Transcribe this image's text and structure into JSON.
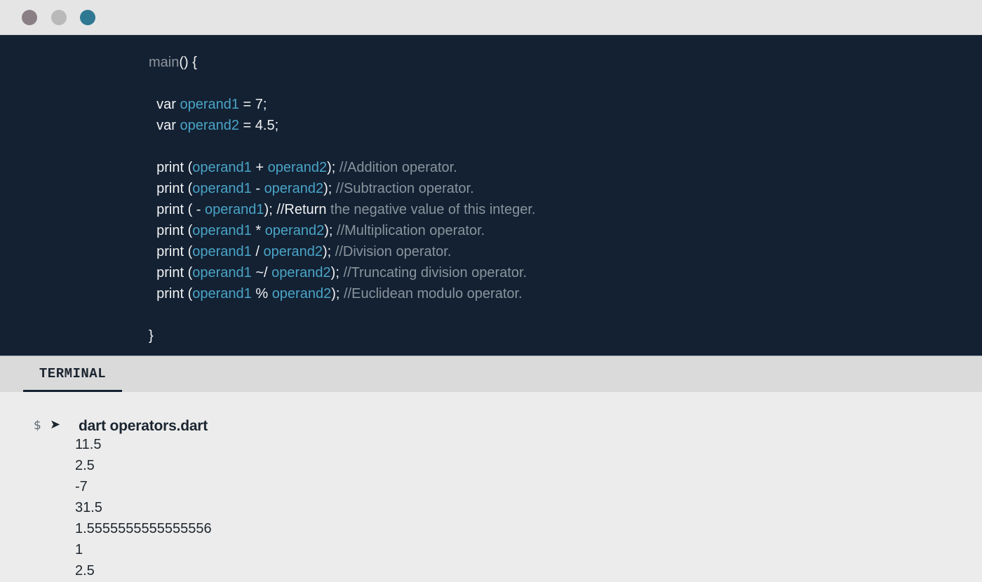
{
  "window": {
    "controls": [
      "close",
      "minimize",
      "maximize"
    ],
    "control_colors": [
      "#8a7f84",
      "#b9b9b9",
      "#2e7892"
    ]
  },
  "editor": {
    "background": "#132133",
    "lines": [
      [
        {
          "t": "main",
          "c": "main"
        },
        {
          "t": "() {",
          "c": "plain"
        }
      ],
      [],
      [
        {
          "t": "  var ",
          "c": "plain"
        },
        {
          "t": "operand1",
          "c": "var"
        },
        {
          "t": " = 7;",
          "c": "plain"
        }
      ],
      [
        {
          "t": "  var ",
          "c": "plain"
        },
        {
          "t": "operand2",
          "c": "var"
        },
        {
          "t": " = 4.5;",
          "c": "plain"
        }
      ],
      [],
      [
        {
          "t": "  print (",
          "c": "plain"
        },
        {
          "t": "operand1",
          "c": "var"
        },
        {
          "t": " + ",
          "c": "plain"
        },
        {
          "t": "operand2",
          "c": "var"
        },
        {
          "t": "); ",
          "c": "plain"
        },
        {
          "t": "//Addition operator.",
          "c": "comment"
        }
      ],
      [
        {
          "t": "  print (",
          "c": "plain"
        },
        {
          "t": "operand1",
          "c": "var"
        },
        {
          "t": " - ",
          "c": "plain"
        },
        {
          "t": "operand2",
          "c": "var"
        },
        {
          "t": "); ",
          "c": "plain"
        },
        {
          "t": "//Subtraction operator.",
          "c": "comment"
        }
      ],
      [
        {
          "t": "  print ( - ",
          "c": "plain"
        },
        {
          "t": "operand1",
          "c": "var"
        },
        {
          "t": "); //Return ",
          "c": "plain"
        },
        {
          "t": "the negative value of this integer.",
          "c": "comment"
        }
      ],
      [
        {
          "t": "  print (",
          "c": "plain"
        },
        {
          "t": "operand1",
          "c": "var"
        },
        {
          "t": " * ",
          "c": "plain"
        },
        {
          "t": "operand2",
          "c": "var"
        },
        {
          "t": "); ",
          "c": "plain"
        },
        {
          "t": "//Multiplication operator.",
          "c": "comment"
        }
      ],
      [
        {
          "t": "  print (",
          "c": "plain"
        },
        {
          "t": "operand1",
          "c": "var"
        },
        {
          "t": " / ",
          "c": "plain"
        },
        {
          "t": "operand2",
          "c": "var"
        },
        {
          "t": "); ",
          "c": "plain"
        },
        {
          "t": "//Division operator.",
          "c": "comment"
        }
      ],
      [
        {
          "t": "  print (",
          "c": "plain"
        },
        {
          "t": "operand1",
          "c": "var"
        },
        {
          "t": " ~/ ",
          "c": "plain"
        },
        {
          "t": "operand2",
          "c": "var"
        },
        {
          "t": "); ",
          "c": "plain"
        },
        {
          "t": "//Truncating division operator.",
          "c": "comment"
        }
      ],
      [
        {
          "t": "  print (",
          "c": "plain"
        },
        {
          "t": "operand1",
          "c": "var"
        },
        {
          "t": " % ",
          "c": "plain"
        },
        {
          "t": "operand2",
          "c": "var"
        },
        {
          "t": "); ",
          "c": "plain"
        },
        {
          "t": "//Euclidean modulo operator.",
          "c": "comment"
        }
      ],
      [],
      [
        {
          "t": "}",
          "c": "plain"
        }
      ]
    ]
  },
  "terminal_tab": {
    "label": "TERMINAL"
  },
  "terminal": {
    "prompt_symbol": "$",
    "prompt_arrow": "➤",
    "command": "dart operators.dart",
    "output": [
      "11.5",
      "2.5",
      "-7",
      "31.5",
      "1.5555555555555556",
      "1",
      "2.5"
    ]
  }
}
